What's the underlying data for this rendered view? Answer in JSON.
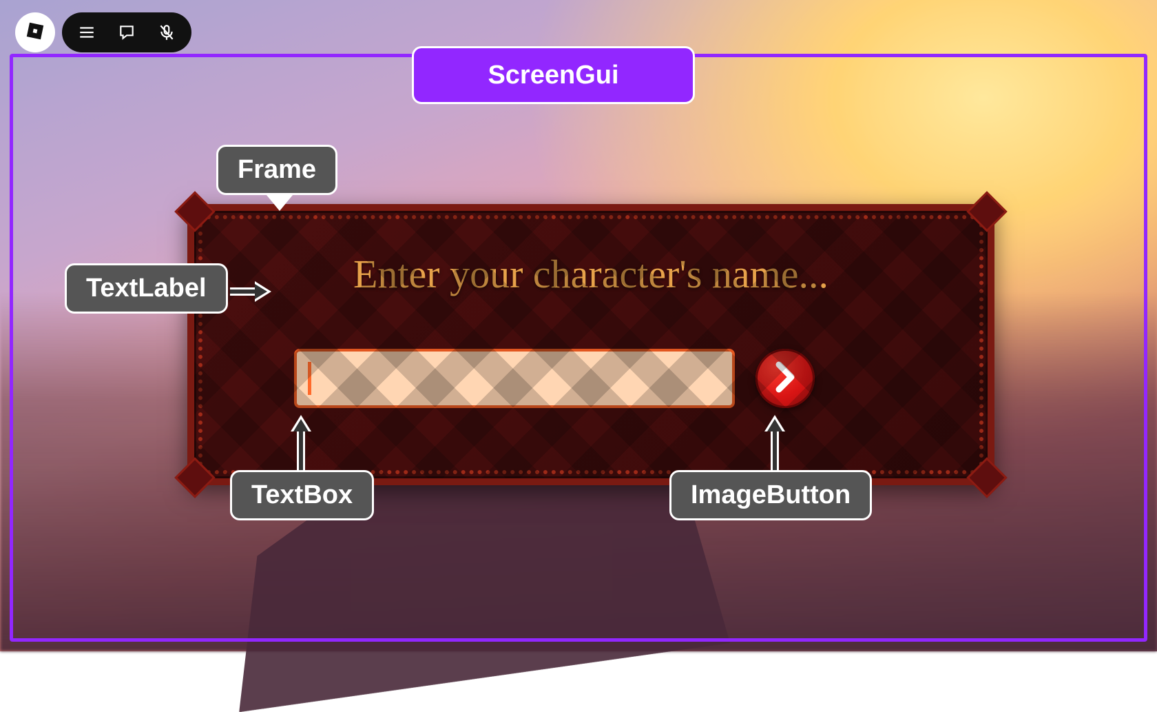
{
  "hud": {
    "logo_icon": "roblox-logo-icon",
    "menu_icon": "hamburger-menu-icon",
    "chat_icon": "chat-bubble-icon",
    "mic_icon": "microphone-muted-icon"
  },
  "labels": {
    "screengui": "ScreenGui",
    "frame": "Frame",
    "textlabel": "TextLabel",
    "textbox": "TextBox",
    "imagebutton": "ImageButton"
  },
  "frame": {
    "title": "Enter your character's name...",
    "textbox_value": "",
    "submit_icon": "chevron-right-icon"
  },
  "colors": {
    "accent_purple": "#9227ff",
    "callout_grey": "#555555",
    "frame_bg": "#3a0a0a",
    "frame_border": "#7a1a12",
    "title_gold": "#e7a24a",
    "textbox_bg": "#ffd6b3",
    "textbox_border": "#e2561f",
    "button_red": "#d81414"
  }
}
